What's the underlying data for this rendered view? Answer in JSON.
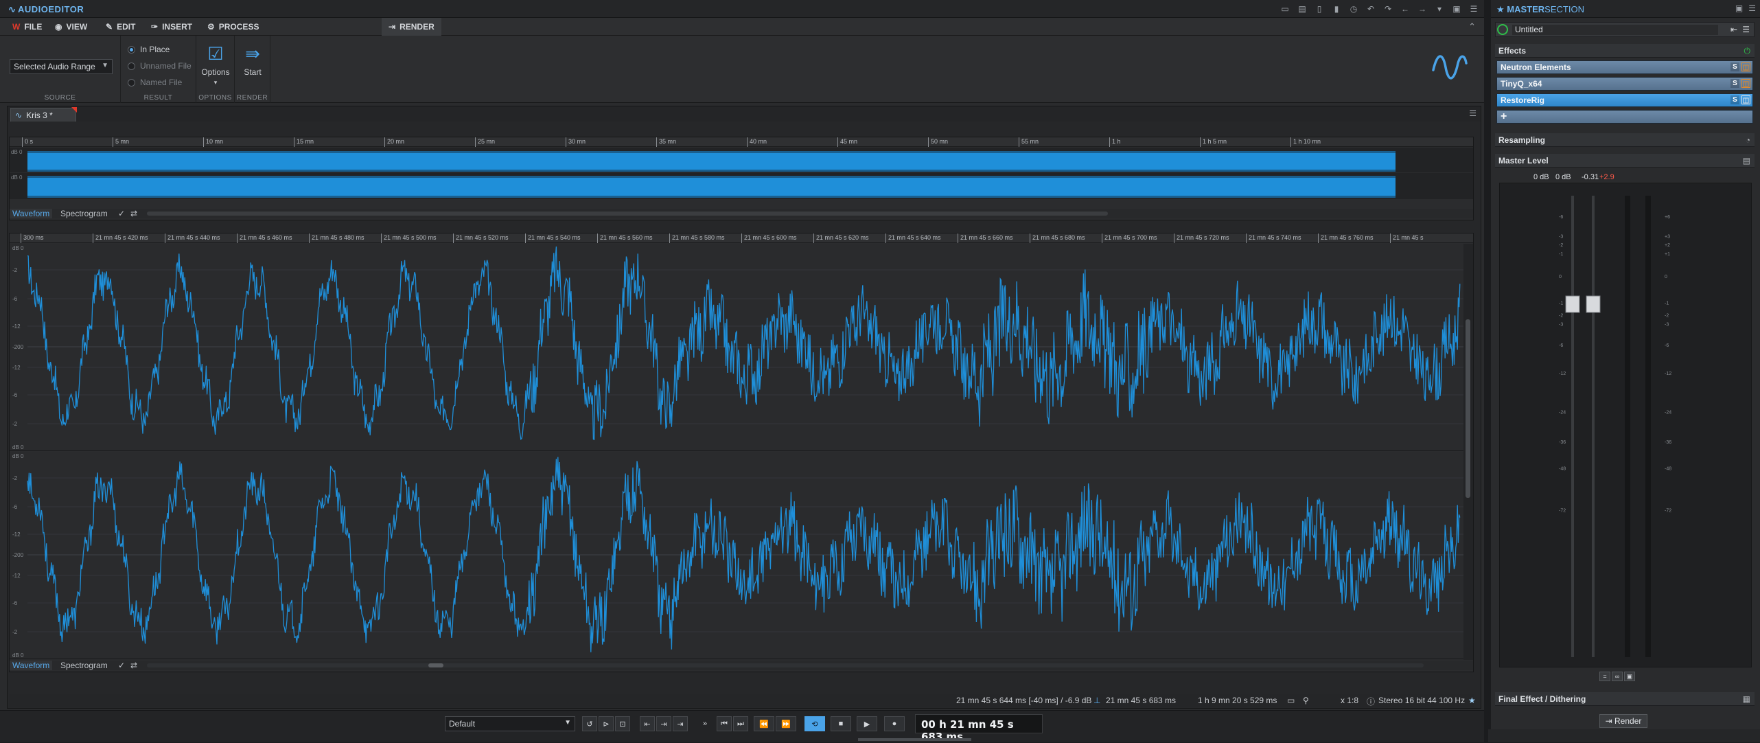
{
  "app": {
    "title_brand": "AUDIO",
    "title_rest": "EDITOR"
  },
  "menu": {
    "file": "FILE",
    "view": "VIEW",
    "edit": "EDIT",
    "insert": "INSERT",
    "process": "PROCESS",
    "render": "RENDER"
  },
  "ribbon": {
    "source": {
      "label": "SOURCE",
      "selected": "Selected Audio Range"
    },
    "result": {
      "label": "RESULT",
      "options": [
        "In Place",
        "Unnamed File",
        "Named File"
      ],
      "selected_index": 0
    },
    "options": {
      "label": "OPTIONS",
      "button": "Options"
    },
    "render": {
      "label": "RENDER",
      "button": "Start"
    }
  },
  "document": {
    "tab_name": "Kris 3 *"
  },
  "overview": {
    "ruler": [
      "0 s",
      "5 mn",
      "10 mn",
      "15 mn",
      "20 mn",
      "25 mn",
      "30 mn",
      "35 mn",
      "40 mn",
      "45 mn",
      "50 mn",
      "55 mn",
      "1 h",
      "1 h 5 mn",
      "1 h 10 mn"
    ],
    "db_label": "dB 0",
    "view_tabs": [
      "Waveform",
      "Spectrogram"
    ]
  },
  "main_view": {
    "ruler": [
      "300 ms",
      "21 mn 45 s 420 ms",
      "21 mn 45 s 440 ms",
      "21 mn 45 s 460 ms",
      "21 mn 45 s 480 ms",
      "21 mn 45 s 500 ms",
      "21 mn 45 s 520 ms",
      "21 mn 45 s 540 ms",
      "21 mn 45 s 560 ms",
      "21 mn 45 s 580 ms",
      "21 mn 45 s 600 ms",
      "21 mn 45 s 620 ms",
      "21 mn 45 s 640 ms",
      "21 mn 45 s 660 ms",
      "21 mn 45 s 680 ms",
      "21 mn 45 s 700 ms",
      "21 mn 45 s 720 ms",
      "21 mn 45 s 740 ms",
      "21 mn 45 s 760 ms",
      "21 mn 45 s"
    ],
    "db_scale": [
      "dB 0",
      "-2",
      "-6",
      "-12",
      "-200",
      "-12",
      "-6",
      "-2",
      "dB 0"
    ],
    "view_tabs": [
      "Waveform",
      "Spectrogram"
    ]
  },
  "status": {
    "cursor": "21 mn 45 s 644 ms [-40 ms] / -6.9 dB",
    "position": "21 mn 45 s 683 ms",
    "length": "1 h 9 mn 20 s 529 ms",
    "zoom": "x 1:8",
    "format": "Stereo 16 bit 44 100 Hz"
  },
  "transport": {
    "preset": "Default",
    "timecode": "00 h 21 mn 45 s 683 ms"
  },
  "master": {
    "title_brand": "MASTER",
    "title_rest": "SECTION",
    "preset": "Untitled",
    "effects_label": "Effects",
    "plugins": [
      "Neutron Elements",
      "TinyQ_x64",
      "RestoreRig"
    ],
    "resampling_label": "Resampling",
    "master_level_label": "Master Level",
    "meter_values": [
      "0 dB",
      "0 dB",
      "-0.31",
      "+2.9"
    ],
    "meter_scale_left": [
      "-6",
      "-3",
      "-2",
      "-1",
      "0",
      "-1",
      "-2",
      "-3",
      "-6",
      "-12",
      "-24",
      "-36",
      "-48",
      "-72"
    ],
    "meter_scale_right": [
      "+6",
      "+3",
      "+2",
      "+1",
      "0",
      "-1",
      "-2",
      "-3",
      "-6",
      "-12",
      "-24",
      "-36",
      "-48",
      "-72"
    ],
    "final_label": "Final Effect / Dithering",
    "render_button": "Render"
  },
  "colors": {
    "accent": "#4aa3e8",
    "waveform": "#1f8fd9",
    "peak": "#ff5a4a"
  }
}
